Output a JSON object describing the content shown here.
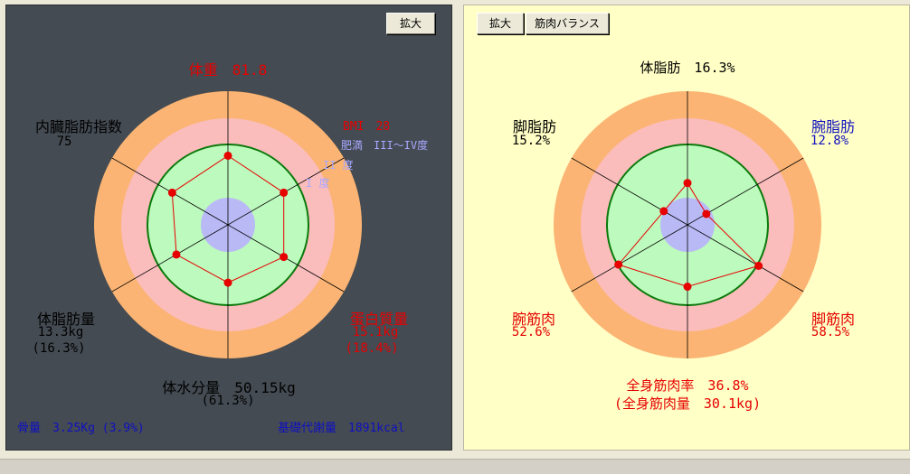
{
  "left": {
    "enlarge_button": "拡大",
    "weight": "体重　81.8",
    "bmi": "BMI　28",
    "obesity": "肥満　III～IV度",
    "degree2": "II 度",
    "degree1": "I 度",
    "visceral_title": "内臓脂肪指数",
    "visceral_value": "75",
    "body_fat_title": "体脂肪量",
    "body_fat_value": "13.3kg",
    "body_fat_pct": "(16.3%)",
    "protein_title": "蛋白質量",
    "protein_value": "15.1kg",
    "protein_pct": "(18.4%)",
    "water_title": "体水分量　50.15kg",
    "water_pct": "(61.3%)",
    "bone": "骨量　3.25Kg (3.9%)",
    "bmr": "基礎代謝量　1891kcal",
    "radar_points": [
      {
        "axis": "weight",
        "level": 0.86
      },
      {
        "axis": "bmi",
        "level": 0.8
      },
      {
        "axis": "protein",
        "level": 0.8
      },
      {
        "axis": "water",
        "level": 0.72
      },
      {
        "axis": "body_fat",
        "level": 0.74
      },
      {
        "axis": "visceral",
        "level": 0.8
      }
    ]
  },
  "right": {
    "enlarge_button": "拡大",
    "balance_button": "筋肉バランス",
    "body_fat_title": "体脂肪　16.3%",
    "leg_fat_title": "脚脂肪",
    "leg_fat_value": "15.2%",
    "arm_fat_title": "腕脂肪",
    "arm_fat_value": "12.8%",
    "arm_muscle_title": "腕筋肉",
    "arm_muscle_value": "52.6%",
    "leg_muscle_title": "脚筋肉",
    "leg_muscle_value": "58.5%",
    "total_muscle_rate": "全身筋肉率　36.8%",
    "total_muscle_mass": "(全身筋肉量　30.1kg)",
    "radar_points": [
      {
        "axis": "body_fat",
        "level": 0.52
      },
      {
        "axis": "arm_fat",
        "level": 0.27
      },
      {
        "axis": "leg_muscle",
        "level": 1.02
      },
      {
        "axis": "total_muscle",
        "level": 0.77
      },
      {
        "axis": "arm_muscle",
        "level": 0.99
      },
      {
        "axis": "leg_fat",
        "level": 0.34
      }
    ]
  },
  "colors": {
    "outer_ring": "#fbb473",
    "middle_ring": "#fbbcbc",
    "inner_ring": "#bdfabd",
    "center": "#b9b9f6",
    "green_circle": "#0a7a0a",
    "polygon": "#e60000",
    "red_text": "#e60000",
    "blue_text": "#1010c0",
    "lavender_text": "#a8a8ff"
  }
}
